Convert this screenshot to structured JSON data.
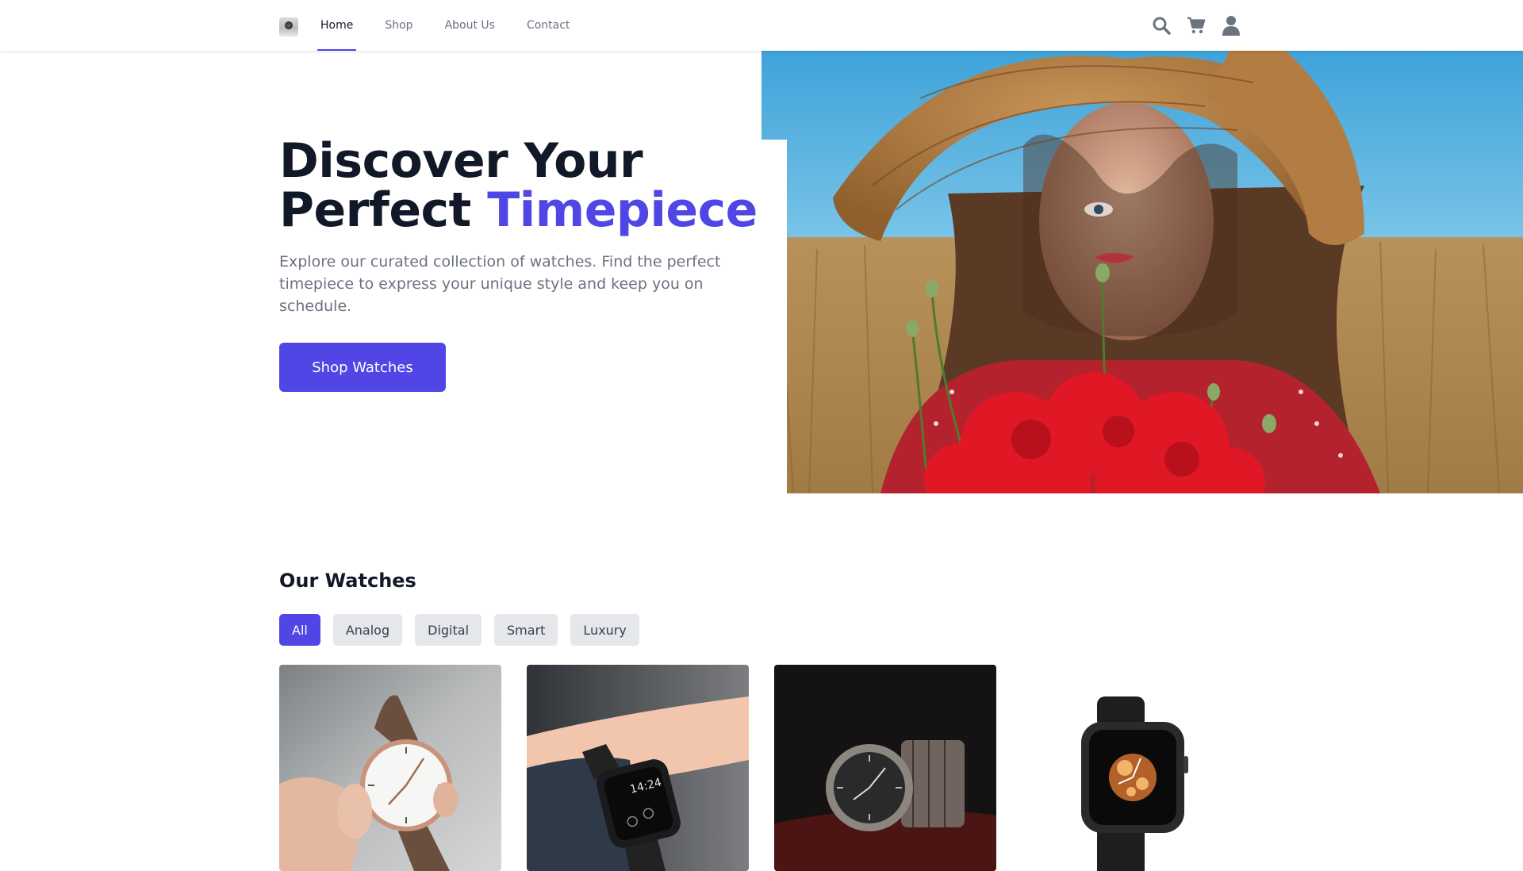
{
  "nav": {
    "items": [
      {
        "label": "Home",
        "active": true
      },
      {
        "label": "Shop",
        "active": false
      },
      {
        "label": "About Us",
        "active": false
      },
      {
        "label": "Contact",
        "active": false
      }
    ],
    "icons": [
      "search-icon",
      "cart-icon",
      "user-icon"
    ]
  },
  "hero": {
    "title_line1": "Discover Your",
    "title_line2_plain": "Perfect ",
    "title_line2_accent": "Timepiece",
    "subtitle": "Explore our curated collection of watches. Find the perfect timepiece to express your unique style and keep you on schedule.",
    "cta_label": "Shop Watches",
    "image_alt": "Woman in straw hat holding red poppies in a wheat field"
  },
  "section": {
    "title": "Our Watches",
    "filters": [
      {
        "label": "All",
        "active": true
      },
      {
        "label": "Analog",
        "active": false
      },
      {
        "label": "Digital",
        "active": false
      },
      {
        "label": "Smart",
        "active": false
      },
      {
        "label": "Luxury",
        "active": false
      }
    ]
  },
  "products": [
    {
      "image": "analog-watch-brown-strap"
    },
    {
      "image": "smartwatch-on-wrist"
    },
    {
      "image": "steel-luxury-watch"
    },
    {
      "image": "black-smartwatch"
    }
  ],
  "colors": {
    "accent": "#4f46e5",
    "text_dark": "#111827",
    "text_muted": "#6b7280",
    "chip_bg": "#e5e7eb"
  }
}
